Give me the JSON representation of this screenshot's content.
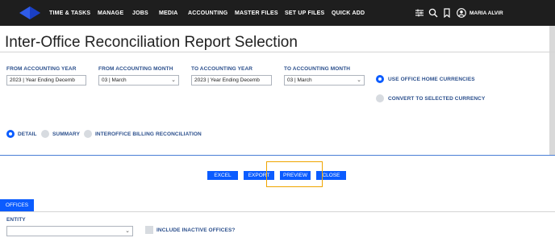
{
  "nav": {
    "items": [
      "TIME & TASKS",
      "MANAGE",
      "JOBS",
      "MEDIA",
      "ACCOUNTING",
      "MASTER FILES",
      "SET UP FILES",
      "QUICK ADD"
    ],
    "user_name": "MARIA ALVIR",
    "icons": [
      "sliders-icon",
      "search-icon",
      "bookmark-icon",
      "user-icon"
    ]
  },
  "page": {
    "title": "Inter-Office Reconciliation Report Selection"
  },
  "filters": {
    "from_year": {
      "label": "FROM ACCOUNTING YEAR",
      "value": "2023 | Year Ending Decemb"
    },
    "from_month": {
      "label": "FROM ACCOUNTING MONTH",
      "value": "03 | March"
    },
    "to_year": {
      "label": "TO ACCOUNTING YEAR",
      "value": "2023 | Year Ending Decemb"
    },
    "to_month": {
      "label": "TO ACCOUNTING MONTH",
      "value": "03 | March"
    }
  },
  "currency": {
    "office_home": "USE OFFICE HOME CURRENCIES",
    "convert": "CONVERT TO SELECTED CURRENCY",
    "selected": "office_home"
  },
  "report_type": {
    "detail": "DETAIL",
    "summary": "SUMMARY",
    "billing": "INTEROFFICE BILLING RECONCILIATION",
    "selected": "detail"
  },
  "actions": {
    "excel": "EXCEL",
    "export": "EXPORT",
    "preview": "PREVIEW",
    "close": "CLOSE"
  },
  "offices": {
    "tab_label": "OFFICES",
    "entity_label": "ENTITY",
    "entity_value": "",
    "include_inactive": "INCLUDE INACTIVE OFFICES?"
  },
  "colors": {
    "topbar": "#1e1e1e",
    "accent": "#0b5cff",
    "label": "#2b4f8c",
    "highlight": "#f0a500"
  }
}
